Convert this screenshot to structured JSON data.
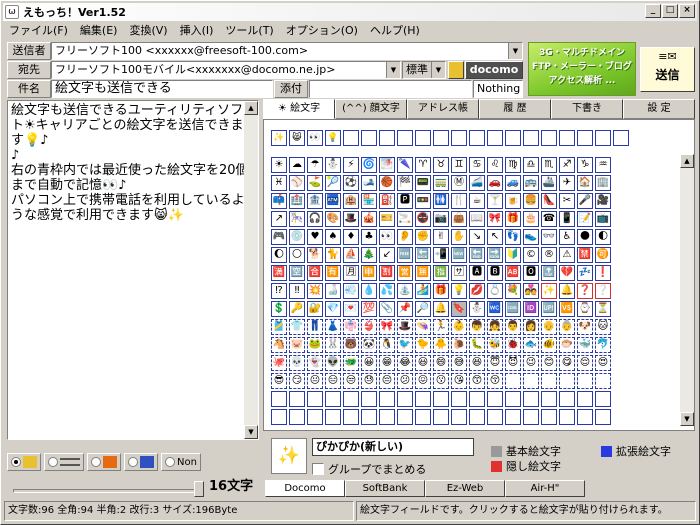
{
  "window": {
    "title": "えもっち！Ver1.52",
    "app_icon": "app-icon",
    "minimize": "_",
    "maximize": "□",
    "close": "×"
  },
  "menu": [
    "ファイル(F)",
    "編集(E)",
    "変換(V)",
    "挿入(I)",
    "ツール(T)",
    "オプション(O)",
    "ヘルプ(H)"
  ],
  "header": {
    "sender_label": "送信者",
    "sender_value": "フリーソフト100 <xxxxxx@freesoft-100.com>",
    "to_label": "宛先",
    "to_value": "フリーソフト100モバイル<xxxxxxx@docomo.ne.jp>",
    "mode_value": "標準",
    "carrier_label": "docomo",
    "subject_label": "件名",
    "subject_value": "絵文字も送信できる",
    "attach_label": "添付",
    "attach_value": "Nothing",
    "banner_line1": "3G・マルチドメイン",
    "banner_line2": "FTP・メーラー・ブログ",
    "banner_line3": "アクセス解析 ...",
    "send_label": "送信",
    "send_icon": "envelope-icon"
  },
  "body_text": [
    "絵文字も送信できるユーティリティソフト☀キャリアごとの絵文字を送信できます💡♪",
    "",
    "♪",
    "右の青枠内では最近使った絵文字を20個まで自動で記憶👀♪",
    "パソコン上で携帯電話を利用しているような感覚で利用できます😸✨"
  ],
  "tabs": [
    "☀ 絵文字",
    "(^^) 顔文字",
    "アドレス帳",
    "履 歴",
    "下書き",
    "設 定"
  ],
  "recent_emoji": [
    "✨",
    "😸",
    "👀",
    "💡",
    "",
    "",
    "",
    "",
    "",
    "",
    "",
    "",
    "",
    "",
    "",
    "",
    "",
    "",
    "",
    ""
  ],
  "emoji_grid": [
    [
      "☀",
      "☁",
      "☂",
      "⛄",
      "⚡",
      "🌀",
      "🌁",
      "🌂",
      "♈",
      "♉",
      "♊",
      "♋",
      "♌",
      "♍",
      "♎",
      "♏",
      "♐",
      "♑",
      "♒"
    ],
    [
      "♓",
      "⚾",
      "⛳",
      "🎾",
      "⚽",
      "🎿",
      "🏀",
      "🏁",
      "📟",
      "🚃",
      "Ⓜ",
      "🚄",
      "🚗",
      "🚙",
      "🚌",
      "🚢",
      "✈",
      "🏠",
      "🏢"
    ],
    [
      "📫",
      "🏥",
      "🏦",
      "🏧",
      "🏨",
      "🏪",
      "⛽",
      "🅿",
      "🚥",
      "🚻",
      "🍴",
      "☕",
      "🍸",
      "🍺",
      "🍔",
      "👠",
      "✂",
      "🎤",
      "🎥"
    ],
    [
      "↗",
      "🎠",
      "🎧",
      "🎨",
      "🎩",
      "🎪",
      "🎫",
      "🚬",
      "🚭",
      "📷",
      "👜",
      "📖",
      "🎀",
      "🎁",
      "🎂",
      "☎",
      "📱",
      "📝",
      "📺"
    ],
    [
      "🎮",
      "💿",
      "♥",
      "♠",
      "♦",
      "♣",
      "👀",
      "👂",
      "✊",
      "✌",
      "✋",
      "↘",
      "↖",
      "👣",
      "👟",
      "👓",
      "♿",
      "🌑",
      "🌓"
    ],
    [
      "🌔",
      "🌕",
      "🐕",
      "🐈",
      "⛵",
      "🎄",
      "↙",
      "🆓",
      "🔙",
      "📲",
      "🆕",
      "🔚",
      "🔜",
      "🔰",
      "©",
      "®",
      "⚠",
      "🈲",
      "🉑"
    ],
    [
      "🈵",
      "🈳",
      "🈴",
      "🈶",
      "🈷",
      "🈸",
      "🈹",
      "🈺",
      "🈚",
      "🈯",
      "🈂",
      "🅰",
      "🅱",
      "🆎",
      "🅾",
      "🔝",
      "💔",
      "💤",
      "❗"
    ],
    [
      "⁉",
      "‼",
      "💥",
      "🍶",
      "💨",
      "💧",
      "💦",
      "⛲",
      "🏄",
      "🎁",
      "💡",
      "💋",
      "💍",
      "💐",
      "💑",
      "✨",
      "🔔",
      "❓",
      "❔"
    ],
    [
      "💲",
      "🔑",
      "🔐",
      "💎",
      "💌",
      "💯",
      "📎",
      "📌",
      "🔎",
      "🔔",
      "🔖",
      "⛄",
      "🚾",
      "🆒",
      "🆔",
      "🆙",
      "🆚",
      "⌚",
      "⏳"
    ],
    [
      "🎽",
      "👕",
      "👖",
      "👗",
      "👘",
      "👙",
      "🎀",
      "🎩",
      "👒",
      "🏃",
      "👶",
      "👦",
      "👧",
      "👨",
      "👩",
      "👴",
      "👵",
      "🐶",
      "🐱"
    ],
    [
      "🐴",
      "🐷",
      "🐸",
      "🐰",
      "🐻",
      "🐼",
      "🐧",
      "🐦",
      "🐤",
      "🐥",
      "🐌",
      "🐛",
      "🐝",
      "🐞",
      "🐟",
      "🐠",
      "🐡",
      "🐳",
      "🐬"
    ],
    [
      "🐙",
      "💀",
      "👻",
      "👽",
      "🐲",
      "😀",
      "😁",
      "😂",
      "😃",
      "😄",
      "😅",
      "😆",
      "😇",
      "😈",
      "😉",
      "😊",
      "😋",
      "😌",
      "😍"
    ],
    [
      "😎",
      "😏",
      "😐",
      "😑",
      "😒",
      "😓",
      "😔",
      "😕",
      "😖",
      "😗",
      "😘",
      "😙",
      "😚",
      "",
      "",
      "",
      "",
      "",
      ""
    ],
    [
      "",
      "",
      "",
      "",
      "",
      "",
      "",
      "",
      "",
      "",
      "",
      "",
      "",
      "",
      "",
      "",
      "",
      "",
      ""
    ],
    [
      "",
      "",
      "",
      "",
      "",
      "",
      "",
      "",
      "",
      "",
      "",
      "",
      "",
      "",
      "",
      "",
      "",
      "",
      ""
    ]
  ],
  "preview": {
    "emoji": "✨",
    "name": "ぴかぴか(新しい)",
    "group_label": "グループでまとめる"
  },
  "legend": {
    "basic": "基本絵文字",
    "extended": "拡張絵文字",
    "hidden": "隠し絵文字",
    "basic_color": "#999999",
    "extended_color": "#2a3ae0",
    "hidden_color": "#e03030"
  },
  "carrier_tabs": [
    "Docomo",
    "SoftBank",
    "Ez-Web",
    "Air-H\""
  ],
  "radio_options": [
    "",
    "",
    "",
    "",
    "Non"
  ],
  "char_limit": "16文字",
  "status_left": "文字数:96 全角:94 半角:2 改行:3 サイズ:196Byte",
  "status_right": "絵文字フィールドです。クリックすると絵文字が貼り付けられます。"
}
